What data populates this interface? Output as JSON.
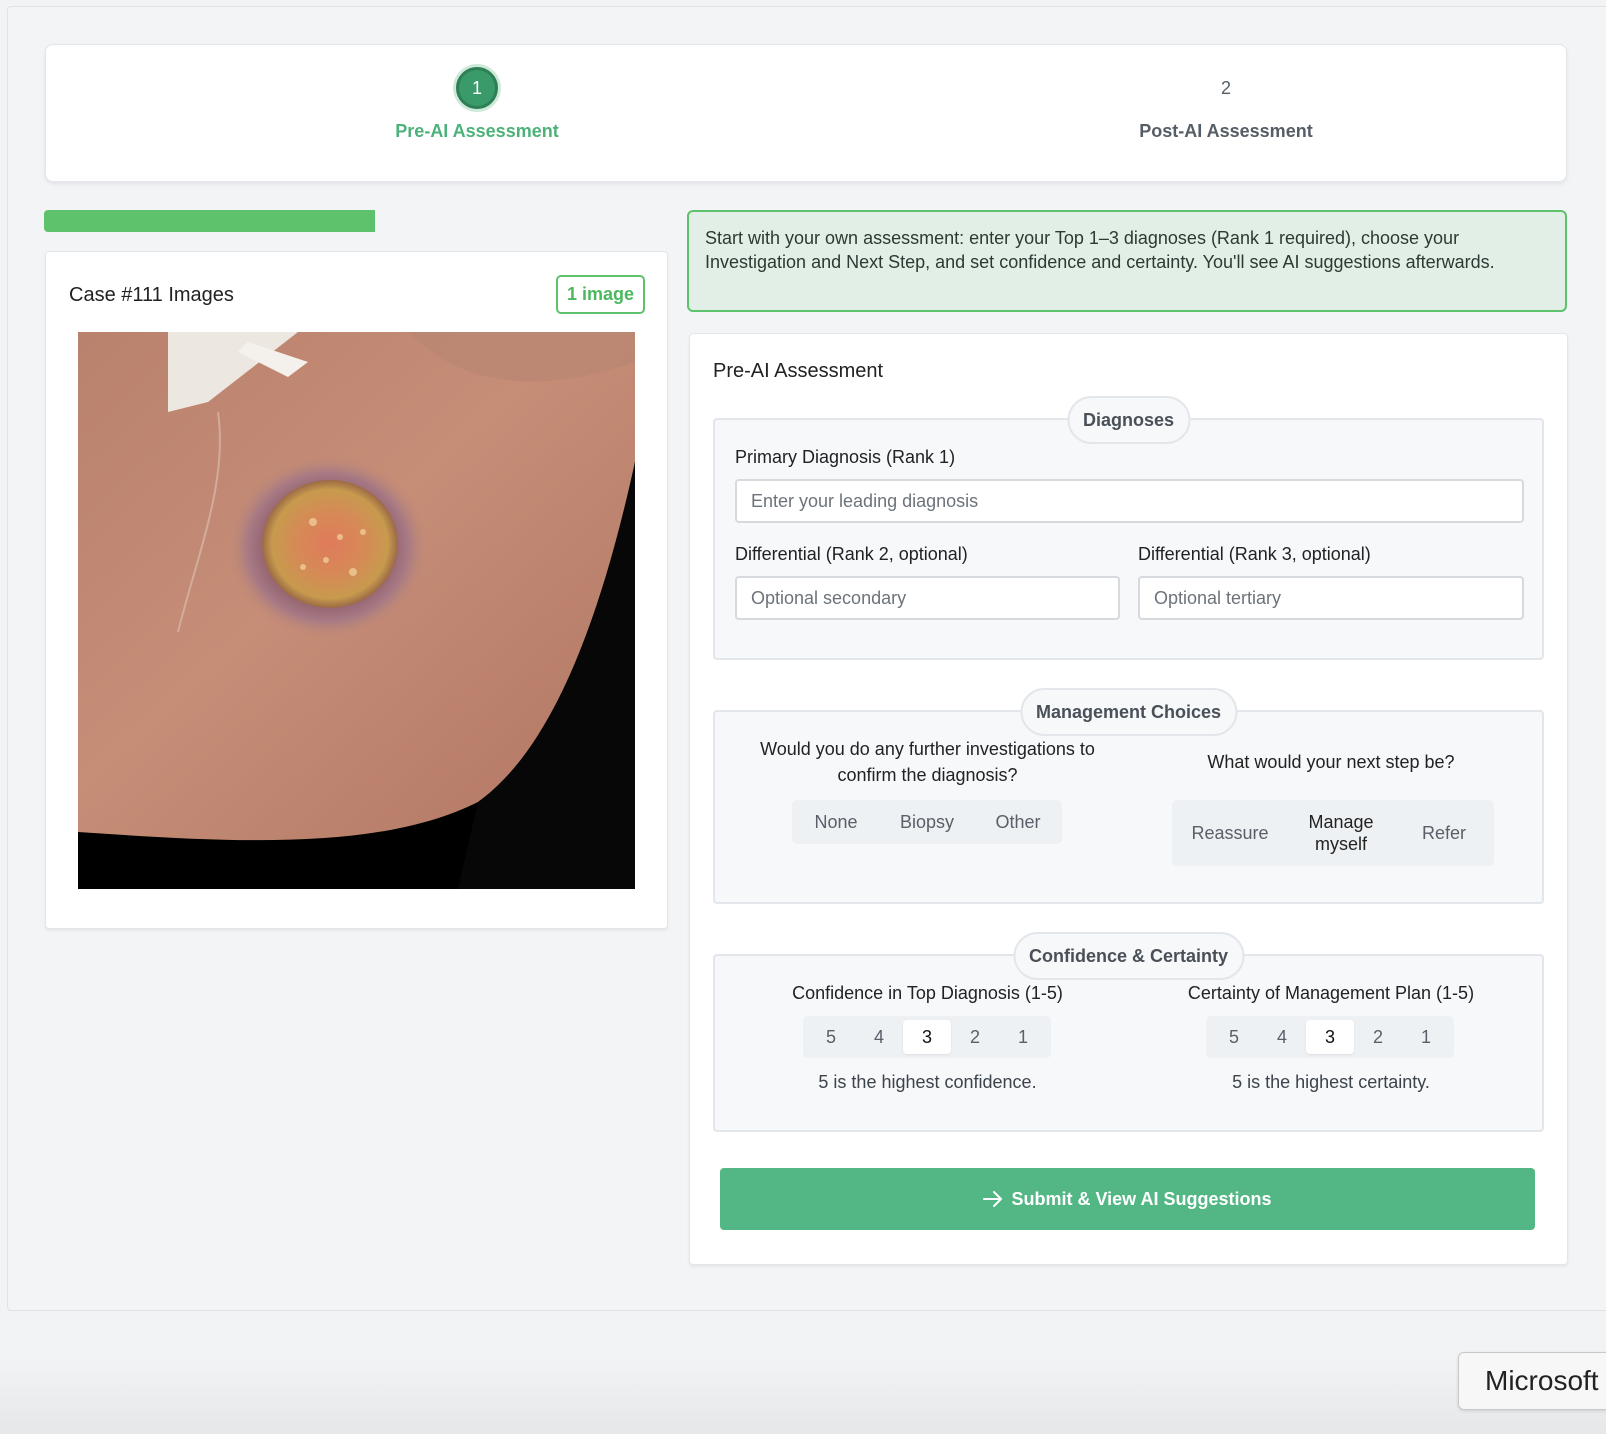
{
  "stepper": {
    "steps": [
      {
        "number": "1",
        "label": "Pre-AI Assessment",
        "active": true
      },
      {
        "number": "2",
        "label": "Post-AI Assessment",
        "active": false
      }
    ]
  },
  "progress": {
    "fraction": 0.53,
    "color": "#5ec26d"
  },
  "images": {
    "title": "Case #111 Images",
    "badge": "1 image"
  },
  "banner": {
    "text": "Start with your own assessment: enter your Top 1–3 diagnoses (Rank 1 required), choose your Investigation and Next Step, and set confidence and certainty. You'll see AI suggestions afterwards."
  },
  "assessment": {
    "title": "Pre-AI Assessment",
    "diagnoses": {
      "legend": "Diagnoses",
      "primary_label": "Primary Diagnosis (Rank 1)",
      "primary_placeholder": "Enter your leading diagnosis",
      "primary_value": "",
      "rank2_label": "Differential (Rank 2, optional)",
      "rank2_placeholder": "Optional secondary",
      "rank3_label": "Differential (Rank 3, optional)",
      "rank3_placeholder": "Optional tertiary"
    },
    "management": {
      "legend": "Management Choices",
      "investigation_question": "Would you do any further investigations to confirm the diagnosis?",
      "investigation_options": [
        "None",
        "Biopsy",
        "Other"
      ],
      "next_step_question": "What would your next step be?",
      "next_step_options": [
        "Reassure",
        "Manage myself",
        "Refer"
      ]
    },
    "confidence": {
      "legend": "Confidence & Certainty",
      "confidence_label": "Confidence in Top Diagnosis (1-5)",
      "confidence_options": [
        "5",
        "4",
        "3",
        "2",
        "1"
      ],
      "confidence_selected": "3",
      "confidence_hint": "5 is the highest confidence.",
      "certainty_label": "Certainty of Management Plan (1-5)",
      "certainty_options": [
        "5",
        "4",
        "3",
        "2",
        "1"
      ],
      "certainty_selected": "3",
      "certainty_hint": "5 is the highest certainty."
    },
    "submit_label": "Submit & View AI Suggestions",
    "submit_icon": "arrow-right-icon"
  },
  "footer": {
    "chip_text": "Microsoft"
  },
  "colors": {
    "accent": "#52b784",
    "active_step": "#3a9a6a",
    "banner_bg": "#e2efe6"
  }
}
